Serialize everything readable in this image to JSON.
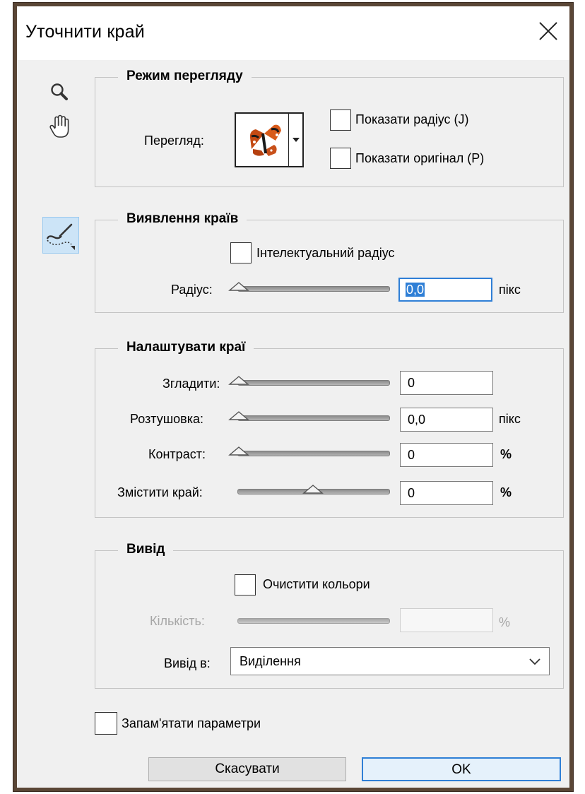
{
  "window": {
    "title": "Уточнити край"
  },
  "view_mode": {
    "legend": "Режим перегляду",
    "view_label": "Перегляд:",
    "show_radius": "Показати радіус (J)",
    "show_original": "Показати оригінал (P)"
  },
  "edge_detection": {
    "legend": "Виявлення країв",
    "smart_radius": "Інтелектуальний радіус",
    "radius_label": "Радіус:",
    "radius_value": "0,0",
    "radius_unit": "пікс"
  },
  "adjust_edge": {
    "legend": "Налаштувати краї",
    "smooth_label": "Згладити:",
    "smooth_value": "0",
    "feather_label": "Розтушовка:",
    "feather_value": "0,0",
    "feather_unit": "пікс",
    "contrast_label": "Контраст:",
    "contrast_value": "0",
    "contrast_unit": "%",
    "shift_label": "Змістити край:",
    "shift_value": "0",
    "shift_unit": "%"
  },
  "output": {
    "legend": "Вивід",
    "decontaminate": "Очистити кольори",
    "amount_label": "Кількість:",
    "amount_unit": "%",
    "output_to_label": "Вивід в:",
    "output_to_value": "Виділення"
  },
  "remember": "Запам'ятати параметри",
  "buttons": {
    "cancel": "Скасувати",
    "ok": "OK"
  },
  "icons": [
    "zoom-icon",
    "hand-icon",
    "refine-radius-brush-icon",
    "close-icon",
    "dropdown-chevron-icon"
  ],
  "colors": {
    "accent": "#2f7fd6",
    "frame": "#5a4636",
    "dialog_bg": "#f0f0f0",
    "tool_selected_bg": "#cce4f7"
  }
}
